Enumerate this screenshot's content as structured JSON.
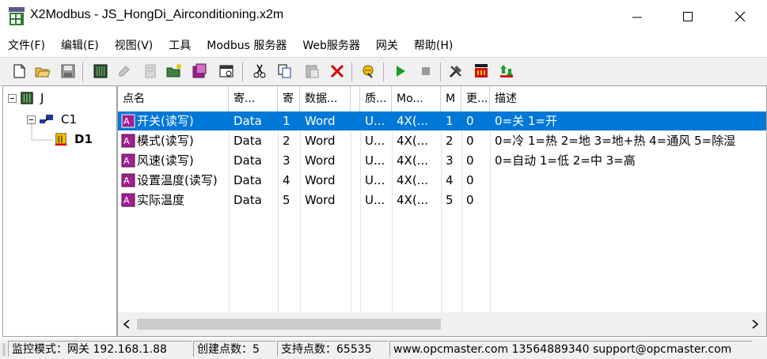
{
  "window": {
    "title": "X2Modbus - JS_HongDi_Airconditioning.x2m"
  },
  "menu": [
    "文件(F)",
    "编辑(E)",
    "视图(V)",
    "工具",
    "Modbus 服务器",
    "Web服务器",
    "网关",
    "帮助(H)"
  ],
  "toolbar": {
    "icons": [
      "new-icon",
      "open-icon",
      "save-icon",
      "device-icon",
      "write-icon",
      "read-icon",
      "add-folder-icon",
      "add-device-icon",
      "properties-icon",
      "cut-icon",
      "copy-icon",
      "paste-icon",
      "delete-icon",
      "monitor-icon",
      "run-icon",
      "stop-icon",
      "tools-icon",
      "load-icon",
      "update-icon"
    ]
  },
  "tree": {
    "root": "J",
    "channel": "C1",
    "device": "D1"
  },
  "grid": {
    "columns": [
      "点名",
      "寄...",
      "寄",
      "数据...",
      "",
      "质...",
      "Mo...",
      "M",
      "更...",
      "描述"
    ],
    "rows": [
      {
        "name": "开关(读写)",
        "area": "Data",
        "reg": "1",
        "dtype": "Word",
        "q": "U...",
        "mo": "4X(...",
        "m": "1",
        "upd": "0",
        "desc": "0=关 1=开",
        "selected": true
      },
      {
        "name": "模式(读写)",
        "area": "Data",
        "reg": "2",
        "dtype": "Word",
        "q": "U...",
        "mo": "4X(...",
        "m": "2",
        "upd": "0",
        "desc": "0=冷 1=热 2=地 3=地+热 4=通风 5=除湿",
        "selected": false
      },
      {
        "name": "风速(读写)",
        "area": "Data",
        "reg": "3",
        "dtype": "Word",
        "q": "U...",
        "mo": "4X(...",
        "m": "3",
        "upd": "0",
        "desc": "0=自动 1=低 2=中 3=高",
        "selected": false
      },
      {
        "name": "设置温度(读写)",
        "area": "Data",
        "reg": "4",
        "dtype": "Word",
        "q": "U...",
        "mo": "4X(...",
        "m": "4",
        "upd": "0",
        "desc": "",
        "selected": false
      },
      {
        "name": "实际温度",
        "area": "Data",
        "reg": "5",
        "dtype": "Word",
        "q": "U...",
        "mo": "4X(...",
        "m": "5",
        "upd": "0",
        "desc": "",
        "selected": false
      }
    ]
  },
  "status": {
    "mode": "监控模式：网关 192.168.1.88",
    "created": "创建点数：5",
    "supported": "支持点数：65535",
    "contact": "www.opcmaster.com 13564889340 support@opcmaster.com"
  },
  "colors": {
    "selection": "#0078d7",
    "tag_icon": "#a0208f",
    "run_green": "#1a9e2a"
  }
}
